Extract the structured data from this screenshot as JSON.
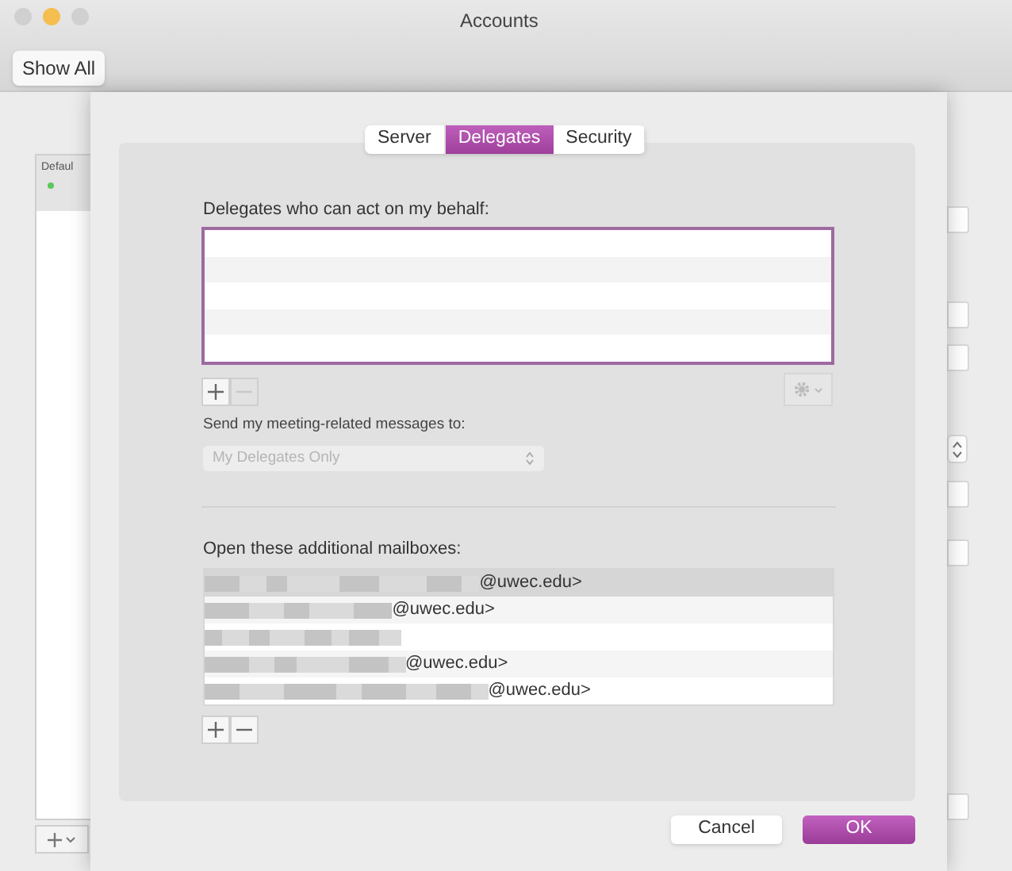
{
  "window": {
    "title": "Accounts"
  },
  "toolbar": {
    "show_all": "Show All"
  },
  "account_list": {
    "items": [
      {
        "label": "Defaul",
        "selected": true
      }
    ]
  },
  "tabs": [
    {
      "label": "Server",
      "selected": false
    },
    {
      "label": "Delegates",
      "selected": true
    },
    {
      "label": "Security",
      "selected": false
    }
  ],
  "delegates": {
    "label": "Delegates who can act on my behalf:",
    "buttons": [
      {
        "kind": "add",
        "disabled": false
      },
      {
        "kind": "remove",
        "disabled": true
      }
    ]
  },
  "meeting": {
    "label": "Send my meeting-related messages to:",
    "popup": {
      "value": "My Delegates Only",
      "disabled": true
    }
  },
  "mailboxes": {
    "label": "Open these additional mailboxes:",
    "rows": [
      {
        "text": "@uwec.edu>",
        "selected": true
      },
      {
        "text": "@uwec.edu>",
        "selected": false
      },
      {
        "selected": false
      },
      {
        "text": "@uwec.edu>",
        "selected": false
      },
      {
        "text": "@uwec.edu>",
        "selected": false
      }
    ],
    "buttons": [
      {
        "kind": "add",
        "disabled": false
      },
      {
        "kind": "remove",
        "disabled": false
      }
    ]
  },
  "footer": [
    {
      "label": "Cancel",
      "default": false
    },
    {
      "label": "OK",
      "default": true
    }
  ]
}
